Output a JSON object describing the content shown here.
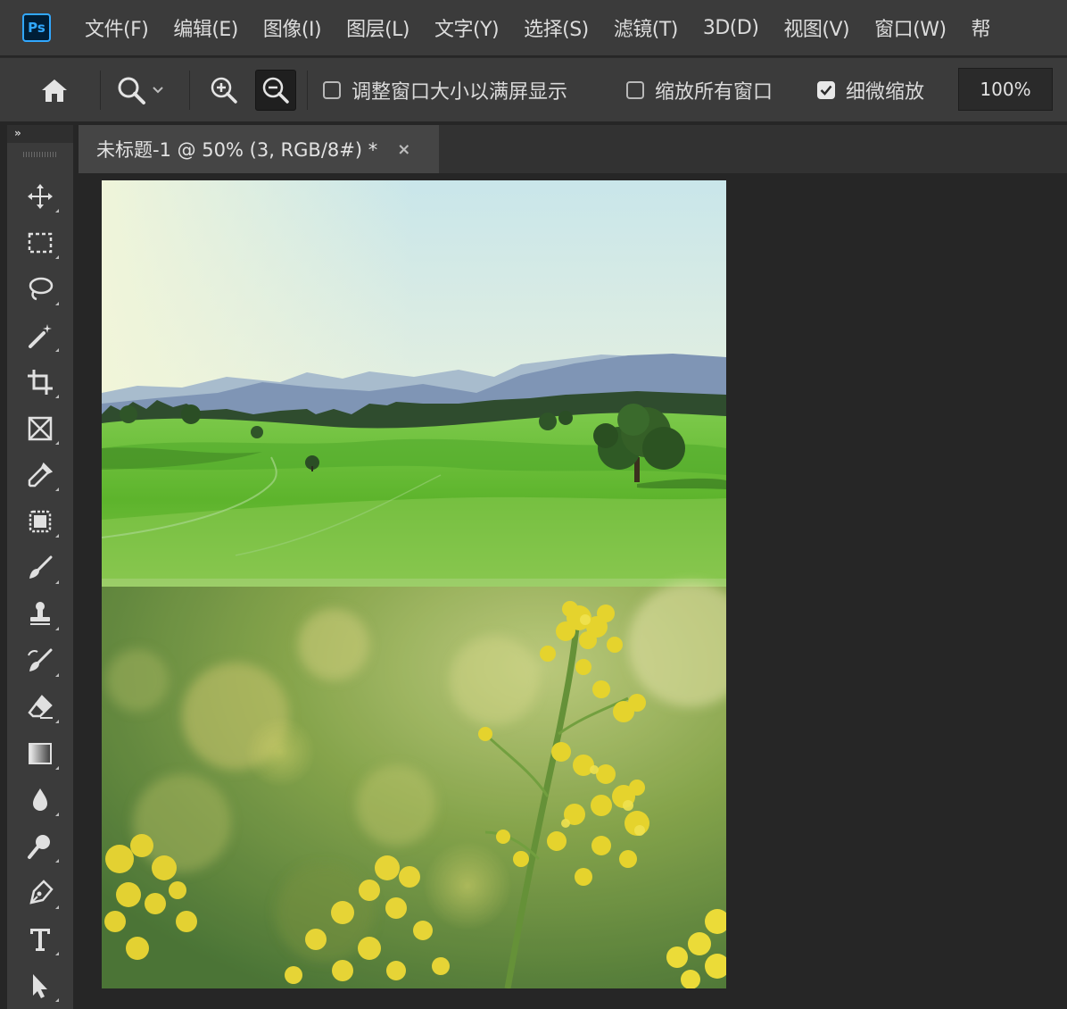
{
  "app": {
    "logo_text": "Ps",
    "menu": [
      "文件(F)",
      "编辑(E)",
      "图像(I)",
      "图层(L)",
      "文字(Y)",
      "选择(S)",
      "滤镜(T)",
      "3D(D)",
      "视图(V)",
      "窗口(W)",
      "帮"
    ]
  },
  "options": {
    "resize_windows": {
      "label": "调整窗口大小以满屏显示",
      "checked": false
    },
    "zoom_all_windows": {
      "label": "缩放所有窗口",
      "checked": false
    },
    "scrubby_zoom": {
      "label": "细微缩放",
      "checked": true
    },
    "zoom_value": "100%"
  },
  "toolbar": {
    "collapse_label": "»",
    "tools": [
      "move-icon",
      "marquee-icon",
      "lasso-icon",
      "magic-wand-icon",
      "crop-icon",
      "frame-icon",
      "eyedropper-icon",
      "healing-icon",
      "brush-icon",
      "stamp-icon",
      "history-brush-icon",
      "eraser-icon",
      "gradient-icon",
      "blur-icon",
      "dodge-icon",
      "pen-icon",
      "type-icon",
      "path-select-icon"
    ]
  },
  "document": {
    "tab_title": "未标题-1 @ 50% (3, RGB/8#) *",
    "close_glyph": "×"
  },
  "colors": {
    "ui_panel": "#3b3b3b",
    "ui_workspace": "#262626",
    "ps_blue": "#31a8ff",
    "meadow_green": "#5fb52c",
    "sky": "#cfe6ea",
    "rapeseed_yellow": "#e6d224"
  }
}
